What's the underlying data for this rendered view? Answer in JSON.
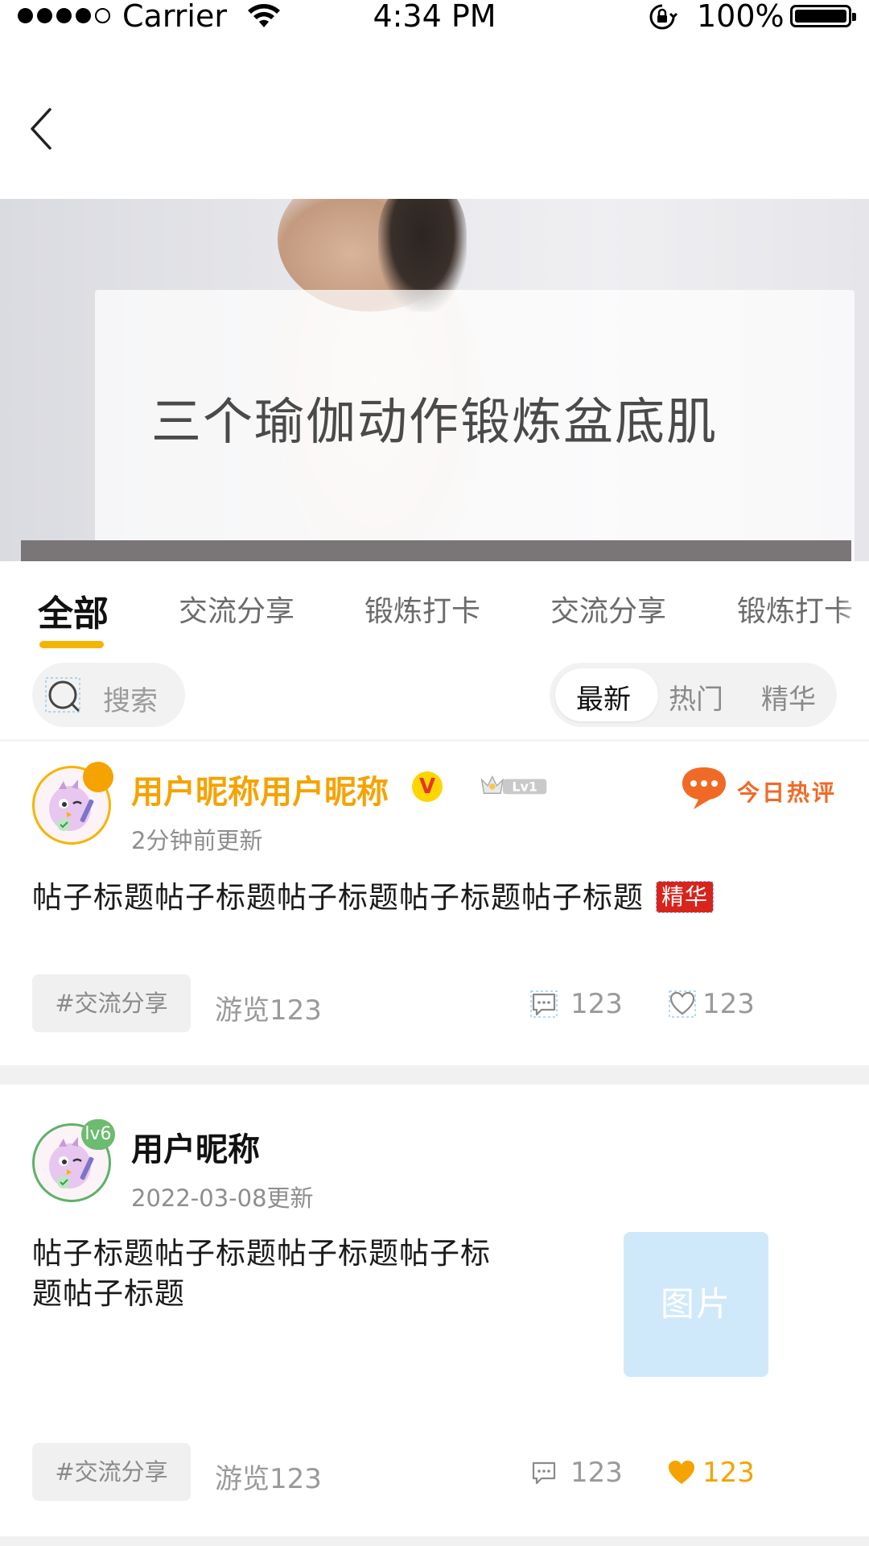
{
  "status_bar": {
    "carrier": "Carrier",
    "time": "4:34 PM",
    "battery": "100%"
  },
  "banner": {
    "title": "三个瑜伽动作锻炼盆底肌"
  },
  "tabs": [
    {
      "label": "全部",
      "active": true
    },
    {
      "label": "交流分享",
      "active": false
    },
    {
      "label": "锻炼打卡",
      "active": false
    },
    {
      "label": "交流分享",
      "active": false
    },
    {
      "label": "锻炼打卡",
      "active": false
    }
  ],
  "search": {
    "placeholder": "搜索"
  },
  "filters": [
    {
      "label": "最新",
      "active": true
    },
    {
      "label": "热门",
      "active": false
    },
    {
      "label": "精华",
      "active": false
    }
  ],
  "posts": [
    {
      "username": "用户昵称用户昵称",
      "verified_badge": "V",
      "level_badge": "Lv1",
      "hot_label": "今日热评",
      "updated": "2分钟前更新",
      "title": "帖子标题帖子标题帖子标题帖子标题帖子标题",
      "essence_badge": "精华",
      "tag": "#交流分享",
      "views": "游览123",
      "comments": "123",
      "likes": "123",
      "liked": false
    },
    {
      "username": "用户昵称",
      "avatar_level": "lv6",
      "updated": "2022-03-08更新",
      "title_line1": "帖子标题帖子标题帖子标题帖子标",
      "title_line2": "题帖子标题",
      "image_placeholder": "图片",
      "tag": "#交流分享",
      "views": "游览123",
      "comments": "123",
      "likes": "123",
      "liked": true
    }
  ],
  "colors": {
    "accent": "#f5b400",
    "username_gold": "#f5a300",
    "essence_red": "#d9241c",
    "image_placeholder": "#cfe9fb",
    "hot_orange": "#f06a26"
  },
  "icons": [
    "back-arrow-icon",
    "search-icon",
    "comment-icon",
    "heart-icon",
    "crown-icon",
    "chat-bubble-icon",
    "wifi-icon",
    "rotation-lock-icon",
    "battery-icon"
  ]
}
